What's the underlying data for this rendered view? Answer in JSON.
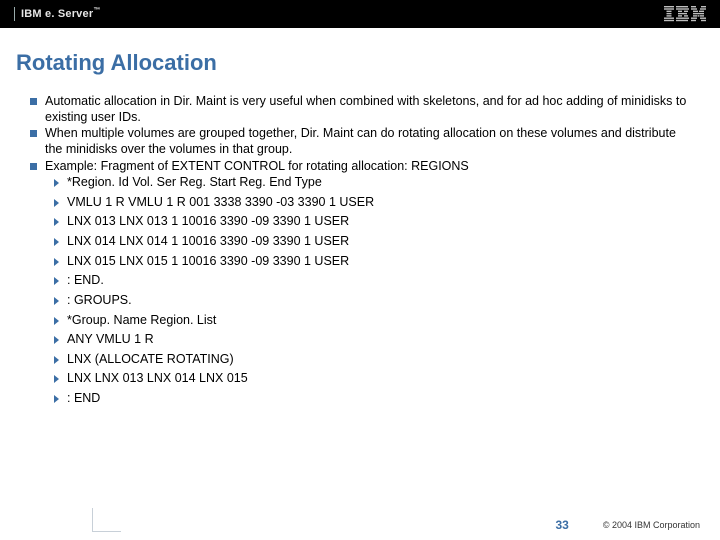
{
  "header": {
    "brand_main": "IBM e. Server",
    "brand_tm": "™",
    "logo_name": "ibm-logo"
  },
  "title": "Rotating Allocation",
  "bullets": [
    "Automatic allocation in Dir. Maint is very useful when combined with skeletons, and for ad hoc adding of minidisks to existing user IDs.",
    "When multiple volumes are grouped together, Dir. Maint can do rotating allocation on these volumes and distribute the minidisks over the volumes in that group.",
    "Example: Fragment of EXTENT CONTROL for rotating allocation: REGIONS"
  ],
  "sublist": [
    "*Region. Id Vol. Ser Reg. Start Reg. End Type",
    "VMLU 1 R VMLU 1 R 001 3338 3390 -03 3390 1 USER",
    "LNX 013 LNX 013 1 10016 3390 -09 3390 1 USER",
    "LNX 014 LNX 014 1 10016 3390 -09 3390 1 USER",
    "LNX 015 LNX 015 1 10016 3390 -09 3390 1 USER",
    ": END.",
    ": GROUPS.",
    "*Group. Name Region. List",
    "ANY VMLU 1 R",
    "LNX (ALLOCATE ROTATING)",
    "LNX LNX 013 LNX 014 LNX 015",
    ": END"
  ],
  "footer": {
    "page": "33",
    "copyright": "© 2004 IBM Corporation"
  }
}
